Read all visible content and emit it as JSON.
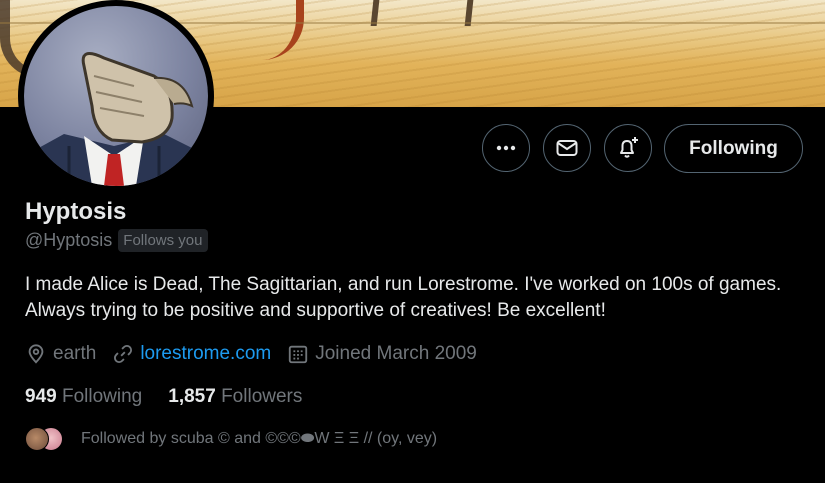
{
  "profile": {
    "display_name": "Hyptosis",
    "handle": "@Hyptosis",
    "follows_you_badge": "Follows you",
    "bio": "I made Alice is Dead, The Sagittarian, and run Lorestrome. I've worked on 100s of games. Always trying to be positive and supportive of creatives! Be excellent!",
    "location": "earth",
    "website": "lorestrome.com",
    "joined": "Joined March 2009"
  },
  "actions": {
    "more_icon": "more-horizontal-icon",
    "message_icon": "envelope-icon",
    "notify_icon": "bell-plus-icon",
    "follow_label": "Following"
  },
  "stats": {
    "following_count": "949",
    "following_label": "Following",
    "followers_count": "1,857",
    "followers_label": "Followers"
  },
  "followed_by": {
    "text": "Followed by scuba © and ©©©⬬W Ξ Ξ // (oy, vey)"
  },
  "colors": {
    "background": "#000000",
    "text_primary": "#e7e9ea",
    "text_secondary": "#71767b",
    "link": "#1d9bf0",
    "button_border": "#536471"
  }
}
